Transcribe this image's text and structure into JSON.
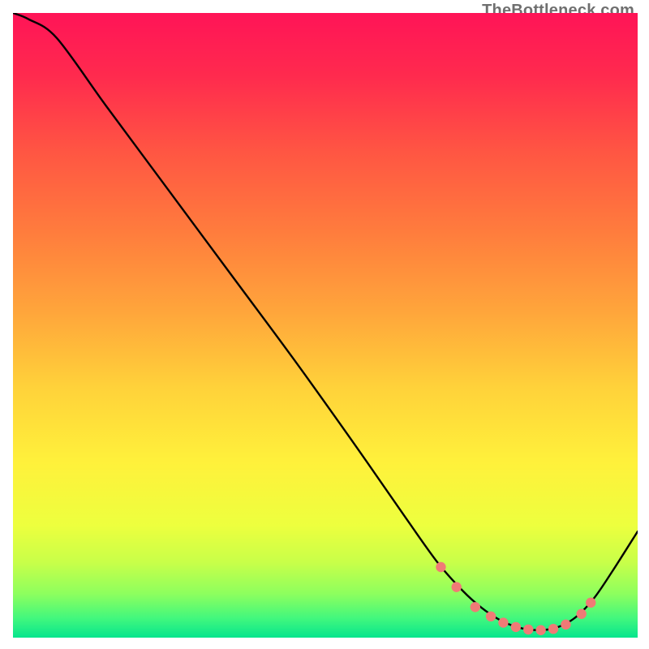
{
  "watermark": {
    "text": "TheBottleneck.com"
  },
  "chart_data": {
    "type": "line",
    "title": "",
    "xlabel": "",
    "ylabel": "",
    "xlim": [
      0,
      100
    ],
    "ylim": [
      0,
      100
    ],
    "grid": false,
    "series": [
      {
        "name": "curve",
        "color": "#000000",
        "x": [
          0,
          2.5,
          7,
          15,
          25,
          35,
          45,
          55,
          63,
          68,
          72,
          75,
          78,
          81,
          84,
          87,
          90,
          93,
          96,
          100
        ],
        "y": [
          100,
          99,
          96,
          85,
          71.5,
          58,
          44.5,
          30.5,
          19,
          12,
          7.5,
          4.8,
          2.8,
          1.6,
          1.2,
          1.6,
          3.2,
          6.3,
          10.7,
          17
        ]
      }
    ],
    "markers": {
      "name": "trough-points",
      "color": "#f07a76",
      "x": [
        68.5,
        71,
        74,
        76.5,
        78.5,
        80.5,
        82.5,
        84.5,
        86.5,
        88.5,
        91,
        92.5
      ],
      "y": [
        11.3,
        8.1,
        4.9,
        3.4,
        2.4,
        1.7,
        1.3,
        1.2,
        1.4,
        2.1,
        3.8,
        5.6
      ]
    },
    "gradient_stops": [
      {
        "offset": 0,
        "color": "#ff1457"
      },
      {
        "offset": 0.1,
        "color": "#ff2a4e"
      },
      {
        "offset": 0.22,
        "color": "#ff5543"
      },
      {
        "offset": 0.35,
        "color": "#ff7c3d"
      },
      {
        "offset": 0.48,
        "color": "#ffa63b"
      },
      {
        "offset": 0.6,
        "color": "#ffd23a"
      },
      {
        "offset": 0.72,
        "color": "#fff13b"
      },
      {
        "offset": 0.82,
        "color": "#edff3e"
      },
      {
        "offset": 0.88,
        "color": "#c8ff49"
      },
      {
        "offset": 0.93,
        "color": "#8dff5e"
      },
      {
        "offset": 0.97,
        "color": "#40f77e"
      },
      {
        "offset": 1.0,
        "color": "#06e58d"
      }
    ]
  }
}
